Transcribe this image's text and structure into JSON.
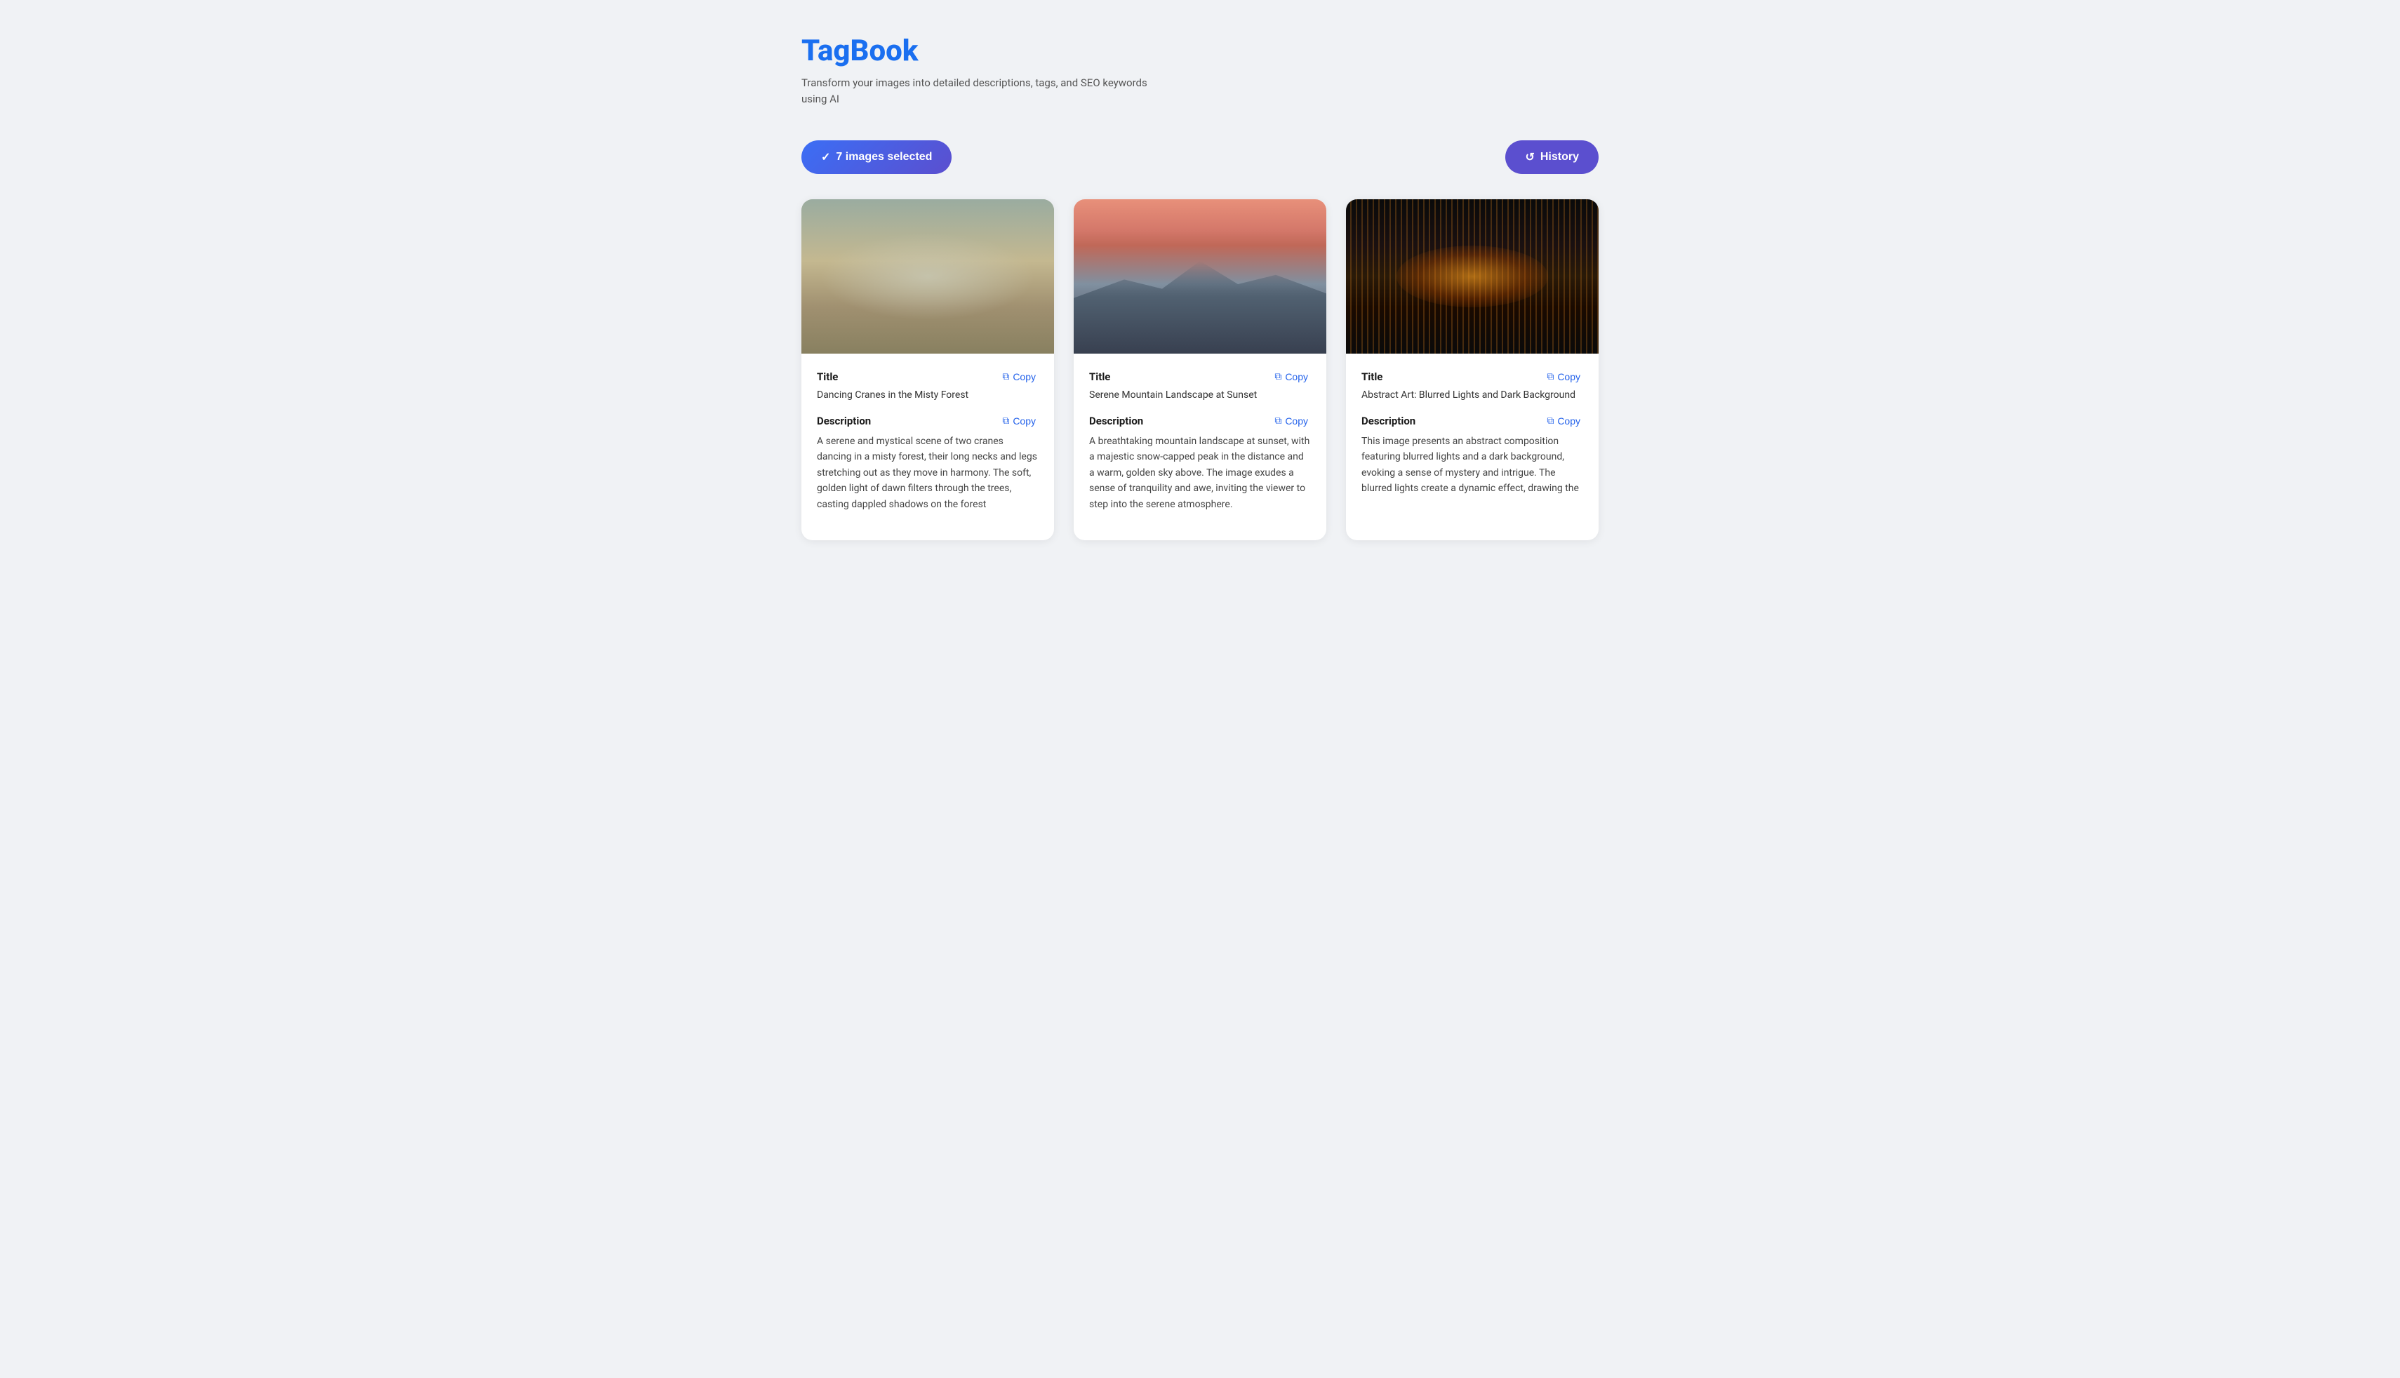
{
  "app": {
    "title": "TagBook",
    "subtitle": "Transform your images into detailed descriptions, tags, and SEO keywords using AI"
  },
  "toolbar": {
    "selected_label": "7 images selected",
    "history_label": "History"
  },
  "cards": [
    {
      "id": "crane",
      "image_type": "crane",
      "title_label": "Title",
      "title_value": "Dancing Cranes in the Misty Forest",
      "description_label": "Description",
      "description_value": "A serene and mystical scene of two cranes dancing in a misty forest, their long necks and legs stretching out as they move in harmony. The soft, golden light of dawn filters through the trees, casting dappled shadows on the forest",
      "copy_label": "Copy"
    },
    {
      "id": "mountain",
      "image_type": "mountain",
      "title_label": "Title",
      "title_value": "Serene Mountain Landscape at Sunset",
      "description_label": "Description",
      "description_value": "A breathtaking mountain landscape at sunset, with a majestic snow-capped peak in the distance and a warm, golden sky above. The image exudes a sense of tranquility and awe, inviting the viewer to step into the serene atmosphere.",
      "copy_label": "Copy"
    },
    {
      "id": "abstract",
      "image_type": "abstract",
      "title_label": "Title",
      "title_value": "Abstract Art: Blurred Lights and Dark Background",
      "description_label": "Description",
      "description_value": "This image presents an abstract composition featuring blurred lights and a dark background, evoking a sense of mystery and intrigue. The blurred lights create a dynamic effect, drawing the",
      "copy_label": "Copy"
    }
  ]
}
